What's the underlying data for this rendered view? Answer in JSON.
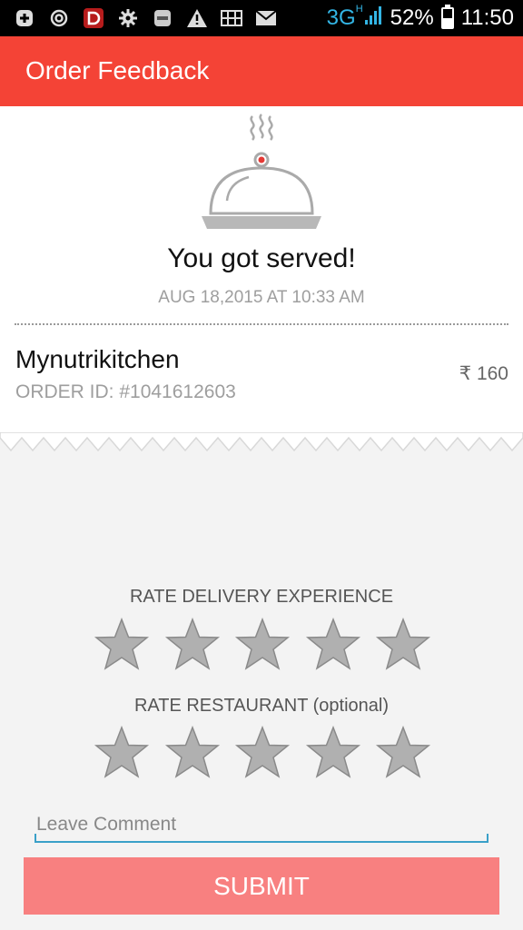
{
  "status_bar": {
    "icons": [
      "add-icon",
      "at-sign-icon",
      "d-app-icon",
      "gear-icon",
      "truecaller-icon",
      "warning-icon",
      "sim-icon",
      "mail-icon"
    ],
    "network": "3G",
    "network_sub": "H",
    "battery": "52%",
    "battery_level": 0.52,
    "time": "11:50"
  },
  "app_bar": {
    "title": "Order Feedback",
    "color": "#f44336"
  },
  "order": {
    "headline": "You got served!",
    "datetime": "AUG 18,2015 AT 10:33 AM",
    "restaurant": "Mynutrikitchen",
    "order_id": "ORDER ID: #1041612603",
    "currency": "₹",
    "amount": "160"
  },
  "ratings": {
    "delivery_label": "RATE DELIVERY EXPERIENCE",
    "restaurant_label": "RATE RESTAURANT (optional)",
    "star_count": 5,
    "star_color": "#b0b0b0"
  },
  "comment": {
    "placeholder": "Leave Comment",
    "value": ""
  },
  "submit": {
    "label": "SUBMIT",
    "color": "#f88080"
  }
}
